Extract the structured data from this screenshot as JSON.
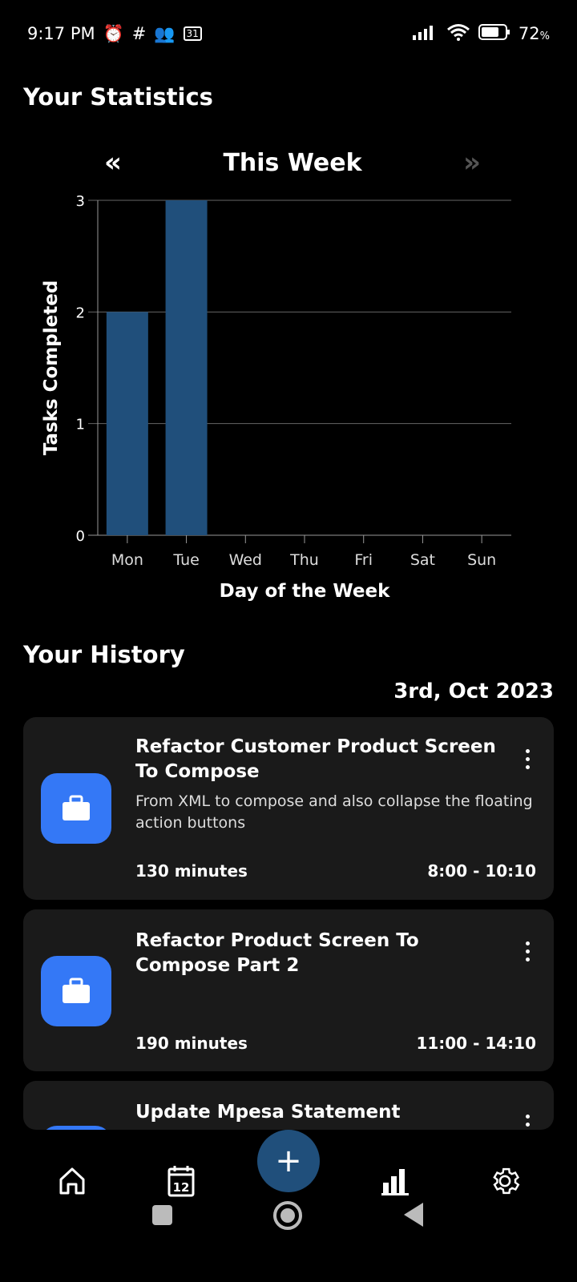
{
  "status_bar": {
    "time": "9:17 PM",
    "calendar_day": "31",
    "battery": "72",
    "battery_unit": "%"
  },
  "statistics": {
    "title": "Your Statistics",
    "week_label": "This Week",
    "prev_icon": "double-chevron-left-icon",
    "next_icon": "double-chevron-right-icon"
  },
  "chart_data": {
    "type": "bar",
    "categories": [
      "Mon",
      "Tue",
      "Wed",
      "Thu",
      "Fri",
      "Sat",
      "Sun"
    ],
    "values": [
      2,
      3,
      0,
      0,
      0,
      0,
      0
    ],
    "xlabel": "Day of the Week",
    "ylabel": "Tasks Completed",
    "ylim": [
      0,
      3
    ],
    "yticks": [
      "0",
      "1",
      "2",
      "3"
    ],
    "grid": true,
    "bar_color": "#204f7b"
  },
  "history": {
    "title": "Your History",
    "date": "3rd, Oct 2023",
    "items": [
      {
        "title": "Refactor Customer Product Screen To Compose",
        "description": "From XML to compose and also collapse the floating action buttons",
        "duration": "130 minutes",
        "time": "8:00 - 10:10"
      },
      {
        "title": "Refactor Product Screen To Compose Part 2",
        "description": "",
        "duration": "190 minutes",
        "time": "11:00 - 14:10"
      },
      {
        "title": "Update Mpesa Statement",
        "description": "",
        "duration": "",
        "time": ""
      }
    ]
  },
  "bottom_nav": {
    "calendar_day": "12",
    "items": [
      "home-icon",
      "calendar-icon",
      "add-icon",
      "stats-icon",
      "settings-icon"
    ],
    "fab_color": "#204f7b"
  },
  "colors": {
    "accent": "#3478f6",
    "card": "#1a1a1a"
  }
}
